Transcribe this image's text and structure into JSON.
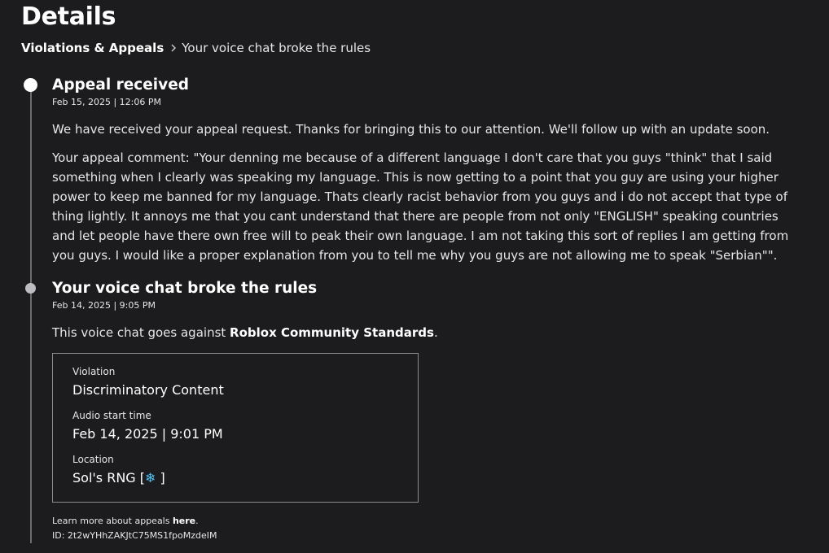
{
  "page_title": "Details",
  "breadcrumb": {
    "parent": "Violations & Appeals",
    "current": "Your voice chat broke the rules"
  },
  "events": [
    {
      "title": "Appeal received",
      "date": "Feb 15, 2025 | 12:06 PM",
      "message": "We have received your appeal request. Thanks for bringing this to our attention. We'll follow up with an update soon.",
      "comment": "Your appeal comment: \"Your denning me because of a different language I don't care that you guys \"think\" that I said something when I clearly was speaking my language. This is now getting to a point that you guy are using your higher power to keep me banned for my language. Thats clearly racist behavior from you guys and i do not accept that type of thing lightly. It annoys me that you cant understand that there are people from not only \"ENGLISH\" speaking countries and let people have there own free will to peak their own language. I am not taking this sort of replies I am getting from you guys. I would like a proper explanation from you to tell me why you guys are not allowing me to speak \"Serbian\"\"."
    },
    {
      "title": "Your voice chat broke the rules",
      "date": "Feb 14, 2025 | 9:05 PM",
      "message_prefix": "This voice chat goes against ",
      "message_link": "Roblox Community Standards",
      "message_suffix": ".",
      "details": {
        "violation_label": "Violation",
        "violation_value": "Discriminatory Content",
        "audio_start_label": "Audio start time",
        "audio_start_value": "Feb 14, 2025 | 9:01 PM",
        "location_label": "Location",
        "location_prefix": "Sol's RNG [",
        "location_icon": "❄",
        "location_suffix": " ]"
      },
      "footer": {
        "learn_more_prefix": "Learn more about appeals ",
        "learn_more_link": "here",
        "learn_more_suffix": ".",
        "id_text": "ID: 2t2wYHhZAKJtC75MS1fpoMzdeIM"
      }
    }
  ]
}
